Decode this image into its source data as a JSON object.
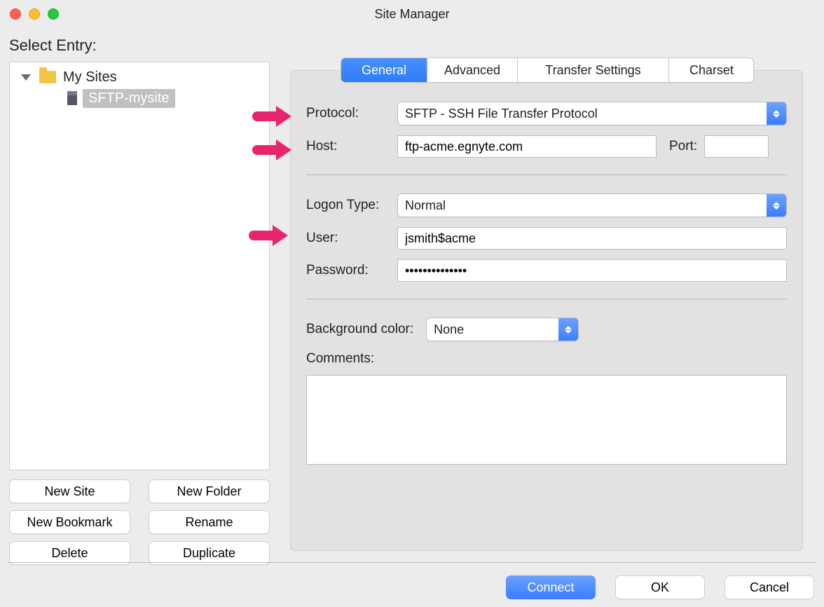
{
  "window": {
    "title": "Site Manager"
  },
  "select_entry_label": "Select Entry:",
  "tree": {
    "parent_label": "My Sites",
    "child_label": "SFTP-mysite"
  },
  "buttons": {
    "new_site": "New Site",
    "new_folder": "New Folder",
    "new_bookmark": "New Bookmark",
    "rename": "Rename",
    "delete": "Delete",
    "duplicate": "Duplicate"
  },
  "tabs": {
    "general": "General",
    "advanced": "Advanced",
    "transfer": "Transfer Settings",
    "charset": "Charset"
  },
  "form": {
    "protocol_label": "Protocol:",
    "protocol_value": "SFTP - SSH File Transfer Protocol",
    "host_label": "Host:",
    "host_value": "ftp-acme.egnyte.com",
    "port_label": "Port:",
    "port_value": "",
    "logon_type_label": "Logon Type:",
    "logon_type_value": "Normal",
    "user_label": "User:",
    "user_value": "jsmith$acme",
    "password_label": "Password:",
    "password_value": "••••••••••••••",
    "bg_color_label": "Background color:",
    "bg_color_value": "None",
    "comments_label": "Comments:",
    "comments_value": ""
  },
  "footer": {
    "connect": "Connect",
    "ok": "OK",
    "cancel": "Cancel"
  }
}
